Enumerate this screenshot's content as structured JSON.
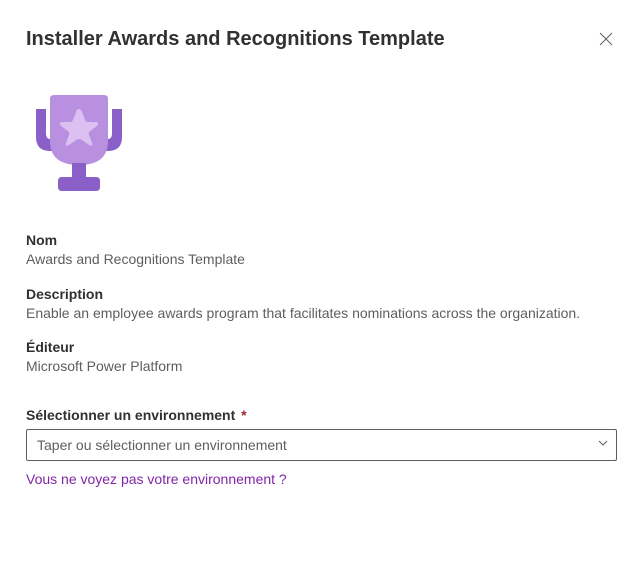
{
  "header": {
    "title": "Installer Awards and Recognitions Template"
  },
  "icon": {
    "name": "trophy-star"
  },
  "fields": {
    "name_label": "Nom",
    "name_value": "Awards and Recognitions Template",
    "description_label": "Description",
    "description_value": "Enable an employee awards program that facilitates nominations across the organization.",
    "publisher_label": "Éditeur",
    "publisher_value": "Microsoft Power Platform"
  },
  "environment": {
    "label": "Sélectionner un environnement",
    "required_mark": "*",
    "placeholder": "Taper ou sélectionner un environnement",
    "value": ""
  },
  "help_link": {
    "label": "Vous ne voyez pas votre environnement ?"
  },
  "colors": {
    "accent": "#8226a9",
    "trophy_light": "#b98fe0",
    "trophy_dark": "#8a5fc7",
    "star": "#d9b8f0"
  }
}
